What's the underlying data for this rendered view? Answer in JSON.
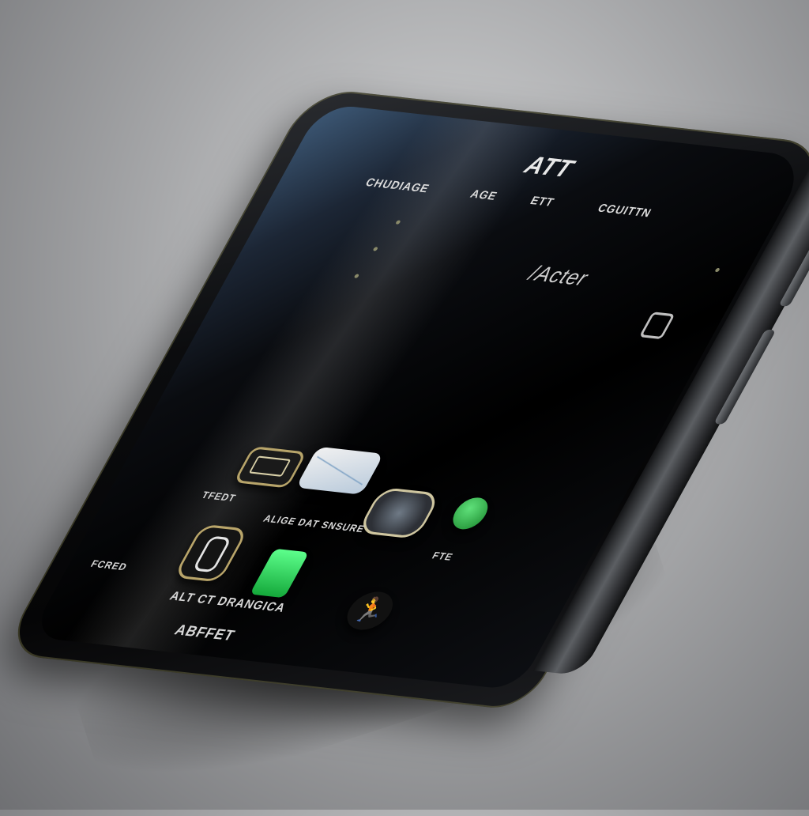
{
  "status_bar": {
    "title": "ATT",
    "items": [
      "CHUDIAGE",
      "AGE",
      "ETT",
      "CGUITTN"
    ]
  },
  "carrier": "/Acter",
  "apps": [
    {
      "label": "TFEDT",
      "icon": "settings-icon"
    },
    {
      "label": "",
      "icon": "mail-icon"
    },
    {
      "label": "",
      "icon": "camera-icon"
    },
    {
      "label": "",
      "icon": "phone-icon"
    }
  ],
  "row_labels": {
    "left": "TFEDT",
    "middle": "ALIGE DAT SNSURE",
    "right": "FTE",
    "lower_left": "FCRED",
    "lower_middle": "ALT CT DRANGICA",
    "bottom": "ABFFET"
  },
  "lower_apps": [
    {
      "icon": "music-icon"
    },
    {
      "icon": "messages-icon"
    },
    {
      "icon": "fitness-icon",
      "glyph": "🏃"
    }
  ],
  "colors": {
    "accent_gold": "#b7a46a",
    "green": "#2ecc4f",
    "screen": "#000000"
  }
}
